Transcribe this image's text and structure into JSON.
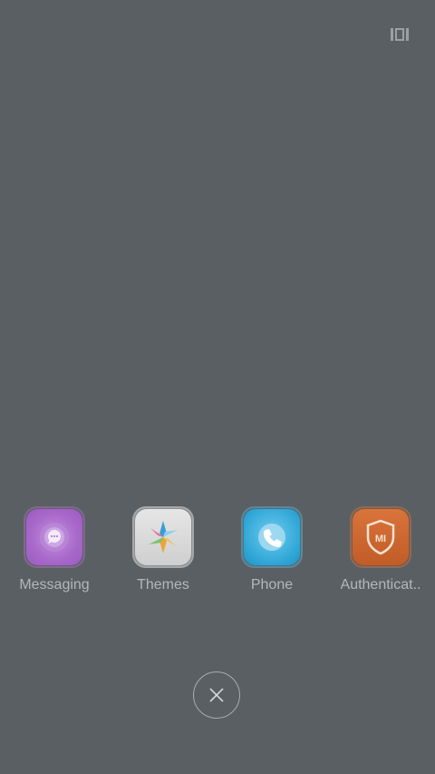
{
  "toolbar": {
    "view_toggle_icon": "tile-view-icon"
  },
  "recent_apps": [
    {
      "label": "Messaging",
      "icon": "messaging-bubble-icon",
      "color": "#a768c9"
    },
    {
      "label": "Themes",
      "icon": "themes-pinwheel-icon",
      "color": "#d9d9d9"
    },
    {
      "label": "Phone",
      "icon": "phone-handset-icon",
      "color": "#2fa6d6"
    },
    {
      "label": "Authenticat..",
      "icon": "mi-shield-icon",
      "color": "#c9652f"
    }
  ],
  "close_all": {
    "icon": "close-icon"
  },
  "colors": {
    "background": "#5a5f63",
    "label": "#b4b7b9"
  }
}
